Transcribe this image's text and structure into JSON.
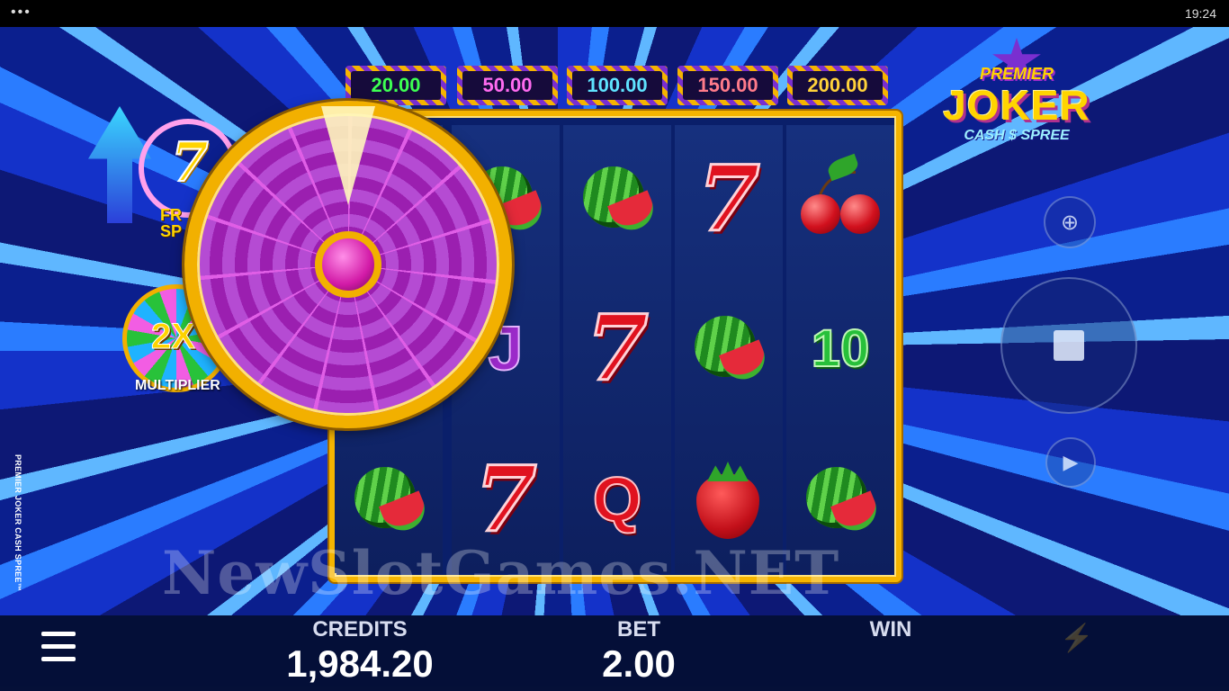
{
  "status_bar": {
    "menu_glyph": "•••",
    "clock": "19:24"
  },
  "game": {
    "vertical_title": "PREMIER JOKER CASH SPREE™"
  },
  "logo": {
    "line1": "PREMIER",
    "line2": "JOKER",
    "line3": "CASH $ SPREE"
  },
  "jackpots": [
    "20.00",
    "50.00",
    "100.00",
    "150.00",
    "200.00"
  ],
  "jackpot_colors": [
    "#3dff52",
    "#ff6bf0",
    "#5fe3ff",
    "#ff7b8a",
    "#ffd23a"
  ],
  "features": {
    "free_spins": {
      "symbol": "7",
      "label_line1": "FR",
      "label_line2": "SP"
    },
    "multiplier": {
      "value": "2X",
      "label": "MULTIPLIER"
    }
  },
  "reels": [
    [
      "watermelon",
      "jack",
      "watermelon"
    ],
    [
      "watermelon",
      "seven",
      "seven"
    ],
    [
      "seven",
      "watermelon",
      "queen"
    ],
    [
      "cherry",
      "ten",
      "strawberry"
    ]
  ],
  "symbol_text": {
    "seven": "7",
    "ten": "10",
    "queen": "Q",
    "jack": "J"
  },
  "reel0": {
    "bottom": "watermelon"
  },
  "controls": {
    "zoom_icon": "zoom-icon",
    "spin_icon": "stop-icon",
    "autoplay_icon": "autoplay-icon",
    "turbo_icon": "lightning-icon"
  },
  "watermark": "NewSlotGames.NET",
  "bottom_bar": {
    "credits_label": "CREDITS",
    "credits_value": "1,984.20",
    "bet_label": "BET",
    "bet_value": "2.00",
    "win_label": "WIN",
    "win_value": ""
  }
}
